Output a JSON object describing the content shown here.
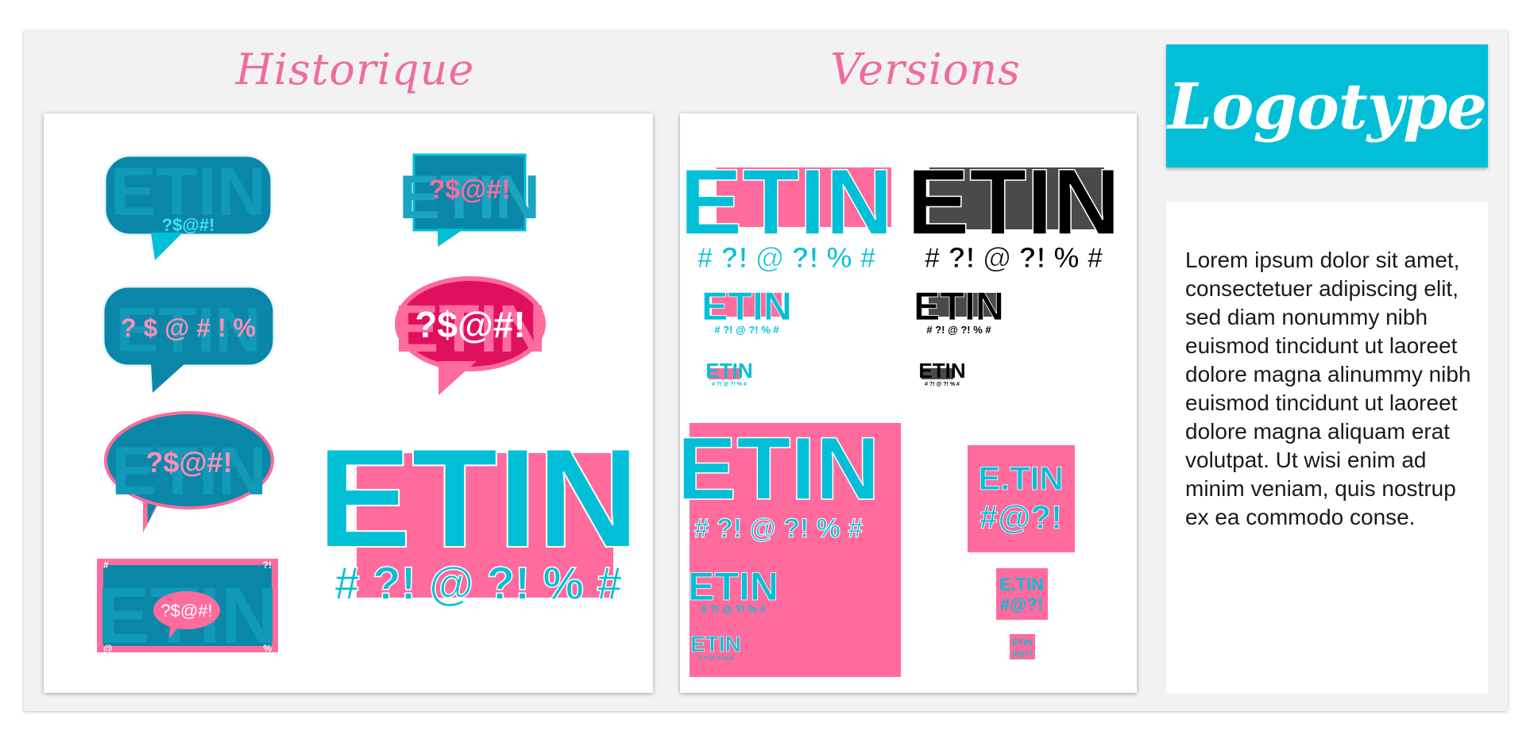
{
  "sections": {
    "historique": {
      "title": "Historique"
    },
    "versions": {
      "title": "Versions"
    },
    "logotype": {
      "title": "Logotype",
      "description": "Lorem ipsum dolor sit amet, consectetuer adipiscing elit, sed diam nonummy nibh euismod tincidunt ut laoreet dolore magna alinummy nibh euismod tincidunt ut laoreet dolore magna aliquam erat volutpat. Ut wisi enim ad minim veniam, quis nostrup ex ea commodo conse."
    }
  },
  "logo": {
    "wordmark": "ETIN",
    "wordmark_dotted": "E.TIN",
    "symbols_full": "# ?! @ ?! % #",
    "symbols_compact": "?$@#!",
    "symbols_spaced": "? $ @ # ! %",
    "symbols_short": "#@?!",
    "corner_hash": "#",
    "corner_bang": "?!",
    "corner_at": "@",
    "corner_pct": "%"
  },
  "colors": {
    "cyan": "#00bfd6",
    "teal": "#0a87a8",
    "pink": "#ff6b9d",
    "magenta": "#e0105e",
    "black": "#000000",
    "grey": "#4a4a4a",
    "title_pink": "#ef6ba0"
  }
}
